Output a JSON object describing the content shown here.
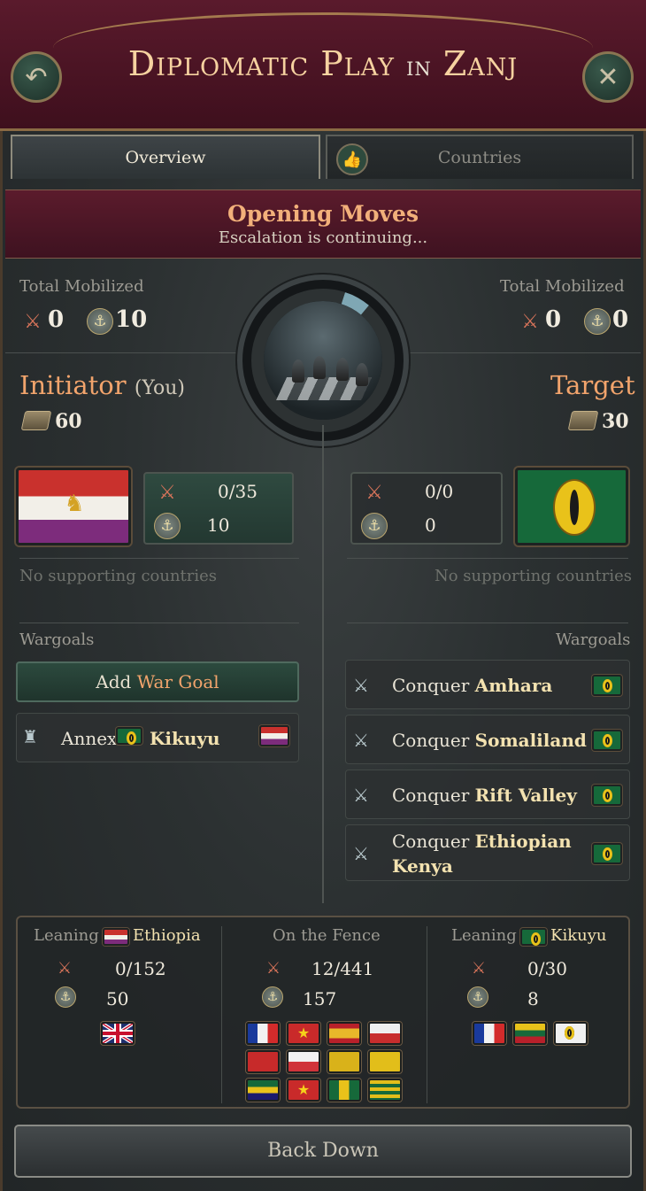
{
  "header": {
    "title_part1": "Diplomatic Play",
    "title_in": "in",
    "title_part2": "Zanj",
    "back_icon": "undo-icon",
    "close_icon": "close-icon"
  },
  "tabs": [
    {
      "label": "Overview"
    },
    {
      "label": "Countries"
    }
  ],
  "phase": {
    "title": "Opening Moves",
    "subtitle": "Escalation is continuing..."
  },
  "initiator": {
    "mobilized_label": "Total Mobilized",
    "army": "0",
    "navy": "10",
    "title": "Initiator",
    "you": "(You)",
    "influence": "60",
    "army_ratio": "0/35",
    "navy_count": "10",
    "supporting": "No supporting countries",
    "wargoals_label": "Wargoals",
    "add_wargoal_prefix": "Add",
    "add_wargoal_hl": "War Goal",
    "wargoals": [
      {
        "verb": "Annex",
        "target": "Kikuyu"
      }
    ]
  },
  "target": {
    "mobilized_label": "Total Mobilized",
    "army": "0",
    "navy": "0",
    "title": "Target",
    "influence": "30",
    "army_ratio": "0/0",
    "navy_count": "0",
    "supporting": "No supporting countries",
    "wargoals_label": "Wargoals",
    "wargoals": [
      {
        "verb": "Conquer",
        "target": "Amhara"
      },
      {
        "verb": "Conquer",
        "target": "Somaliland"
      },
      {
        "verb": "Conquer",
        "target": "Rift Valley"
      },
      {
        "verb": "Conquer",
        "target": "Ethiopian Kenya"
      }
    ]
  },
  "leaning": {
    "left": {
      "label": "Leaning",
      "country": "Ethiopia",
      "army": "0/152",
      "navy": "50"
    },
    "fence": {
      "label": "On the Fence",
      "army": "12/441",
      "navy": "157"
    },
    "right": {
      "label": "Leaning",
      "country": "Kikuyu",
      "army": "0/30",
      "navy": "8"
    }
  },
  "back_down": "Back Down",
  "colors": {
    "accent": "#f2a46c",
    "banner": "#5b1b2c",
    "green_btn": "#2c4a3e"
  }
}
